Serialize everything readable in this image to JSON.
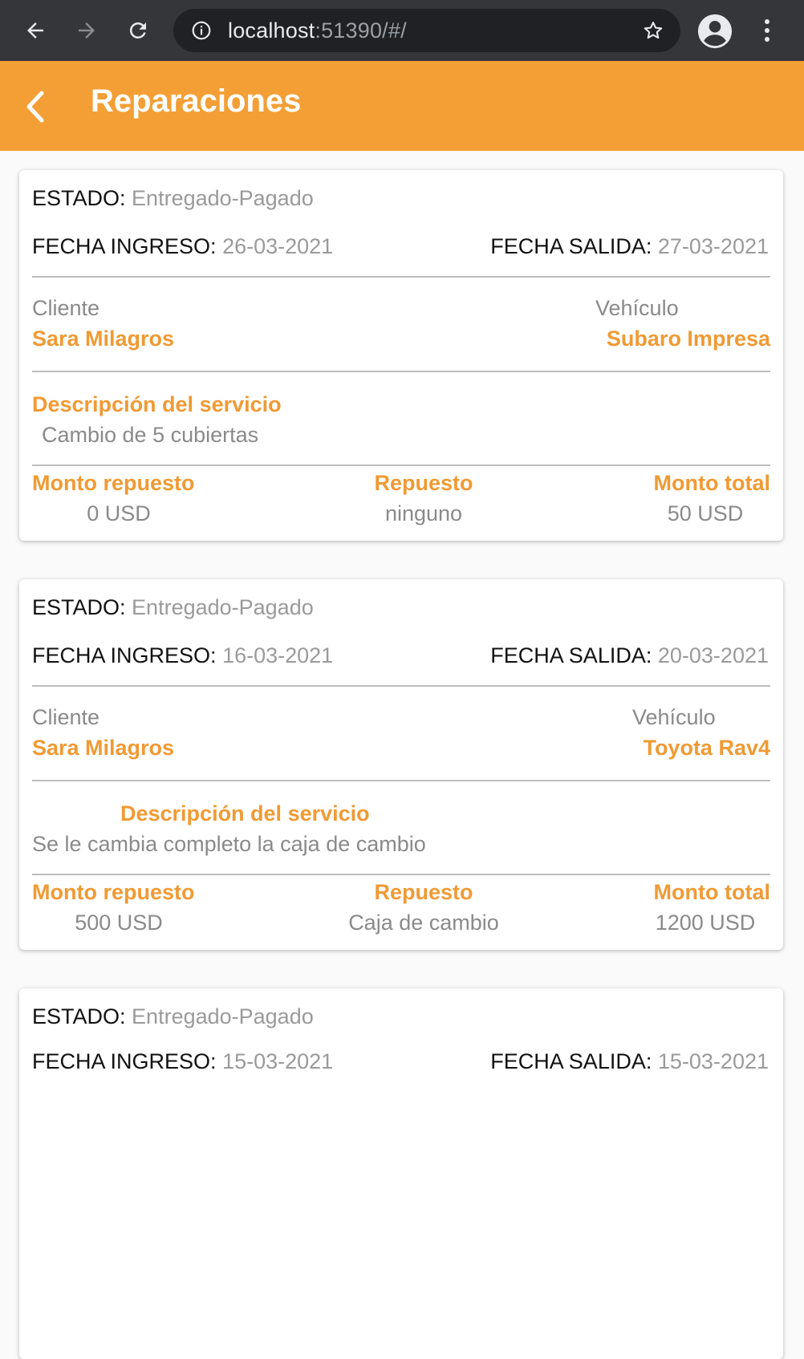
{
  "browser": {
    "url_host": "localhost",
    "url_rest": ":51390/#/"
  },
  "appbar": {
    "title": "Reparaciones"
  },
  "labels": {
    "estado": "ESTADO:",
    "fecha_ingreso": "FECHA INGRESO:",
    "fecha_salida": "FECHA SALIDA:",
    "cliente": "Cliente",
    "vehiculo": "Vehículo",
    "descripcion": "Descripción del servicio",
    "monto_repuesto": "Monto repuesto",
    "repuesto": "Repuesto",
    "monto_total": "Monto total"
  },
  "repairs": [
    {
      "estado": "Entregado-Pagado",
      "fecha_ingreso": "26-03-2021",
      "fecha_salida": "27-03-2021",
      "cliente": "Sara Milagros",
      "vehiculo": "Subaro Impresa",
      "descripcion": "Cambio de 5 cubiertas",
      "monto_repuesto": "0 USD",
      "repuesto": "ninguno",
      "monto_total": "50 USD"
    },
    {
      "estado": "Entregado-Pagado",
      "fecha_ingreso": "16-03-2021",
      "fecha_salida": "20-03-2021",
      "cliente": "Sara Milagros",
      "vehiculo": "Toyota Rav4",
      "descripcion": "Se le cambia completo la caja de cambio",
      "monto_repuesto": "500 USD",
      "repuesto": "Caja de cambio",
      "monto_total": "1200 USD"
    },
    {
      "estado": "Entregado-Pagado",
      "fecha_ingreso": "15-03-2021",
      "fecha_salida": "15-03-2021"
    }
  ]
}
